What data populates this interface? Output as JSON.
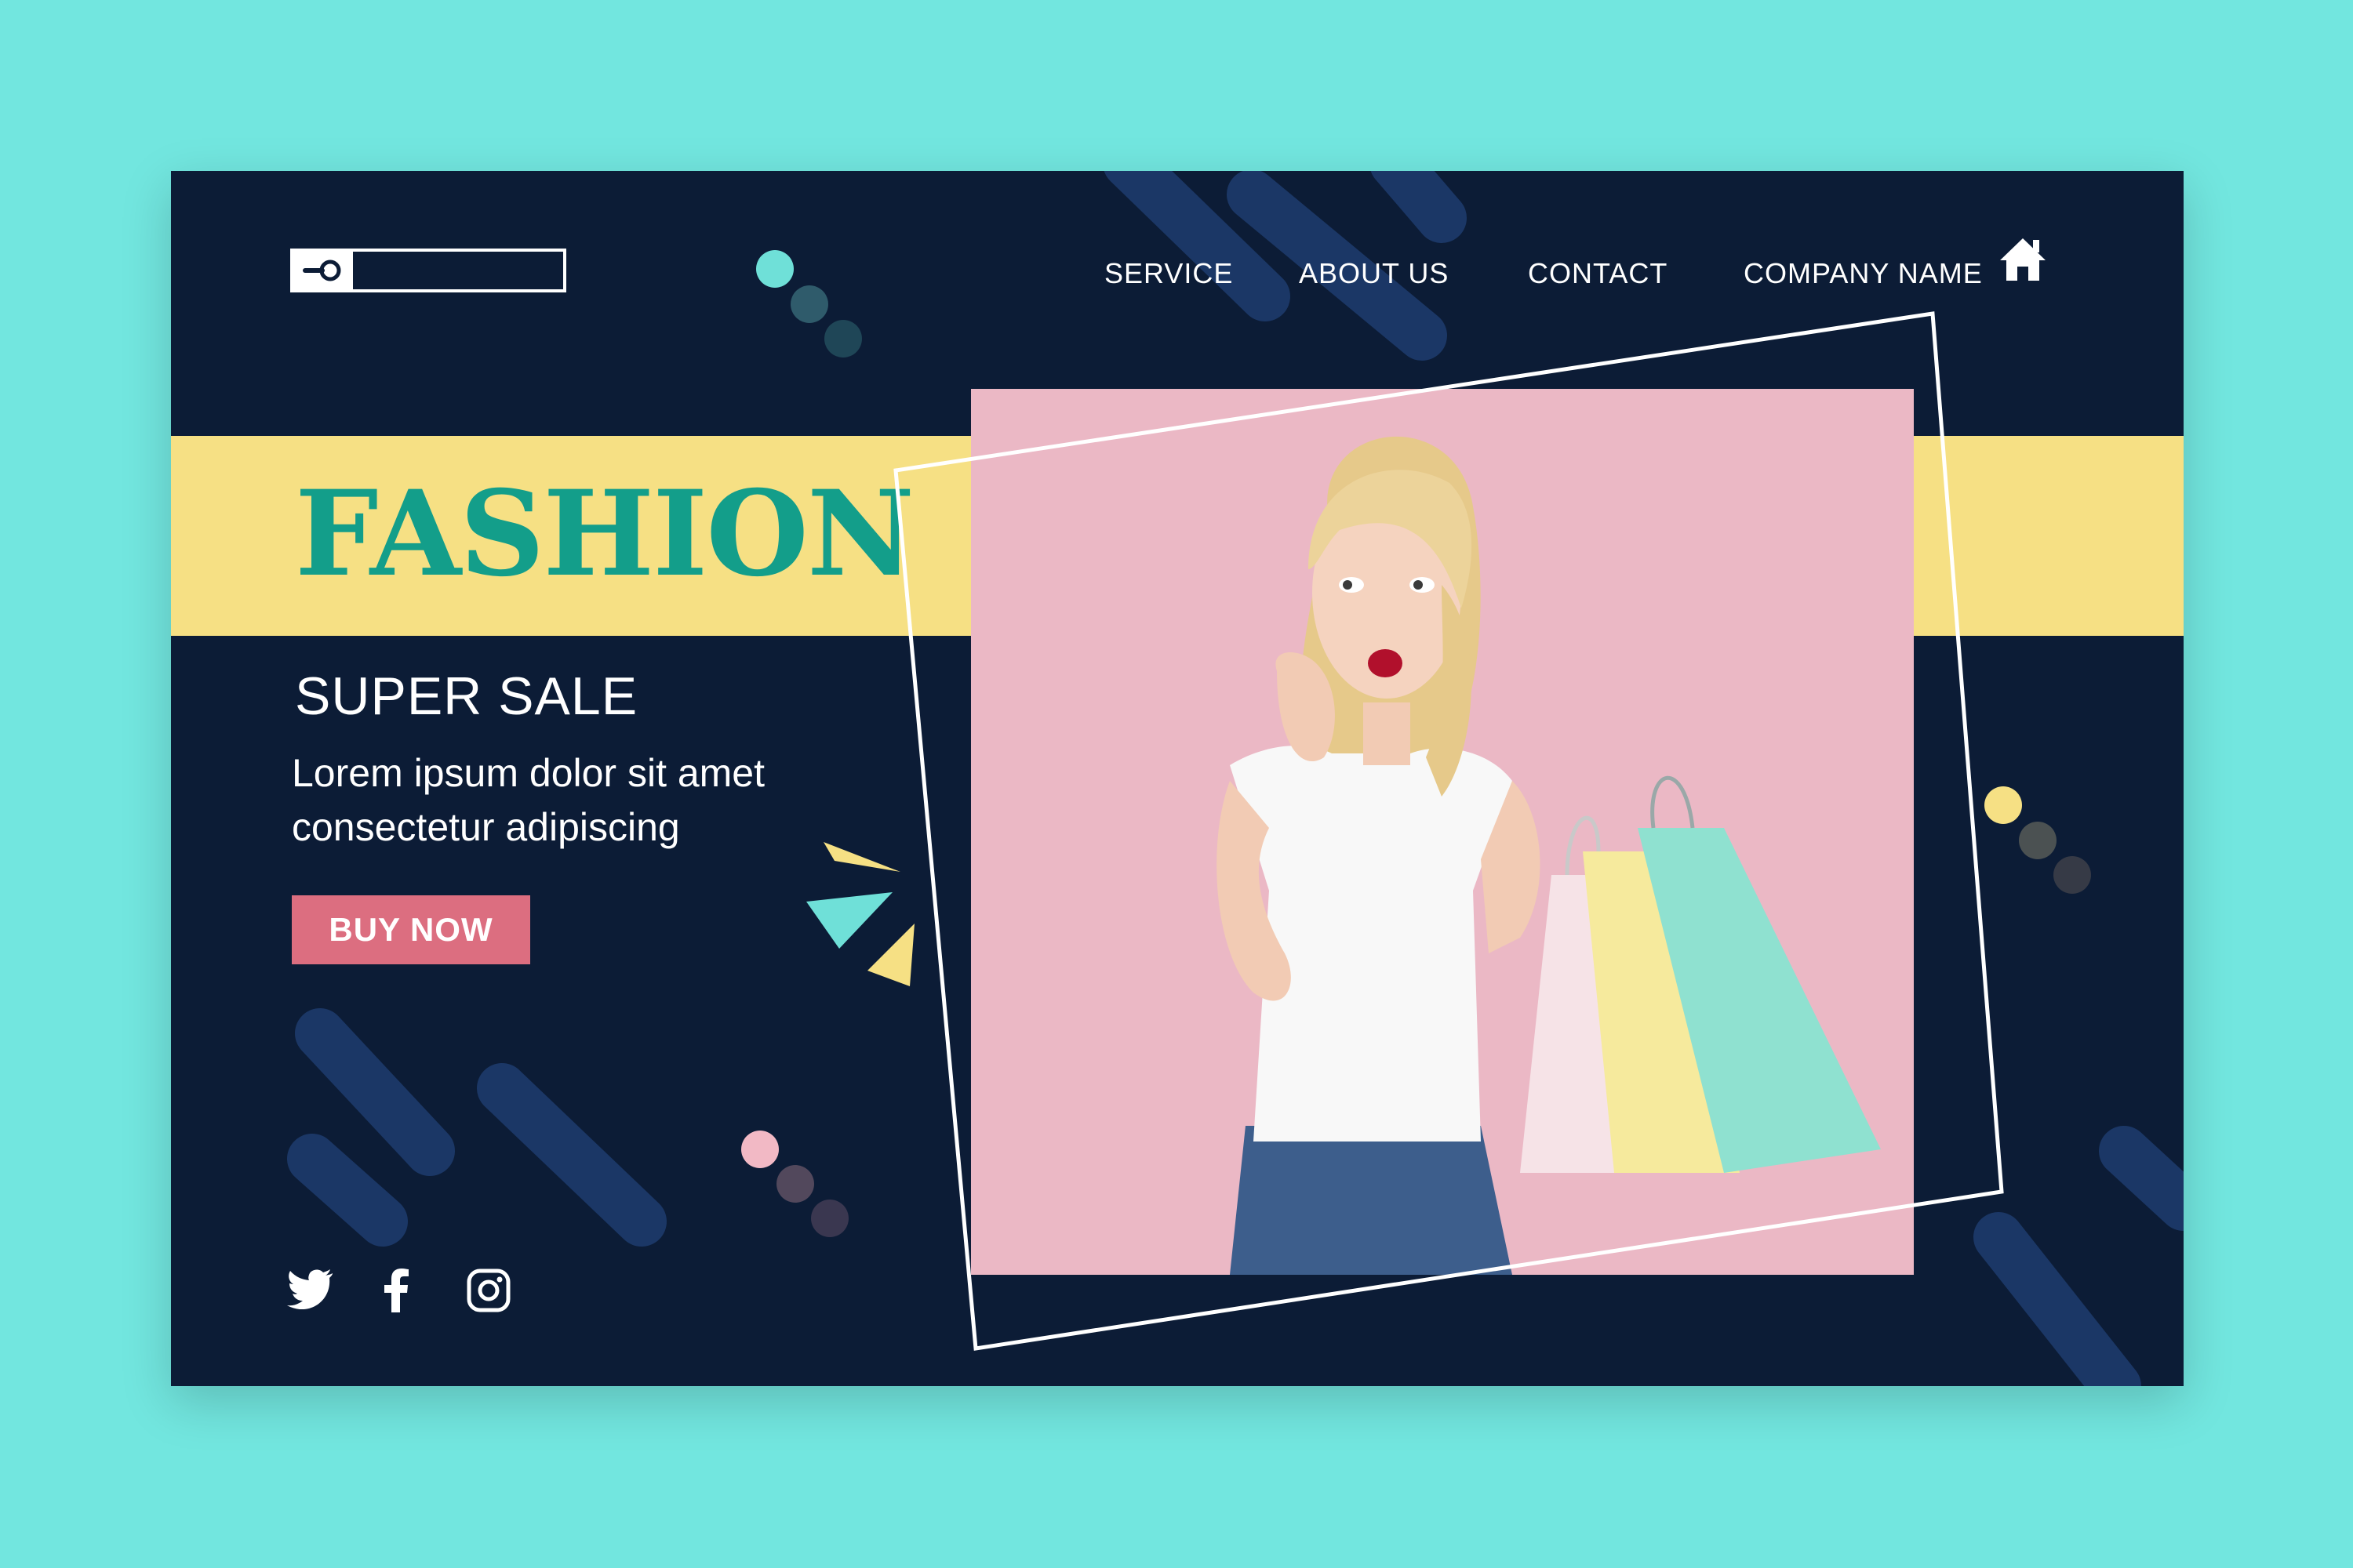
{
  "search": {
    "placeholder": ""
  },
  "nav": {
    "service": "SERVICE",
    "about": "ABOUT US",
    "contact": "CONTACT",
    "company": "COMPANY NAME"
  },
  "hero": {
    "title": "FASHION",
    "subtitle": "SUPER SALE",
    "description": "Lorem ipsum dolor sit amet consectetur adipiscing",
    "cta": "BUY NOW"
  },
  "colors": {
    "background": "#72e6df",
    "card": "#0c1c36",
    "band": "#f6e084",
    "title": "#139e8a",
    "button": "#dc6e80",
    "photo_bg": "#ebb8c5",
    "accent_teal": "#6fe0d8",
    "accent_yellow": "#f6e084",
    "accent_pink": "#dc6e80"
  },
  "icons": {
    "search": "magnifier-icon",
    "home": "home-icon",
    "social": [
      "twitter-icon",
      "facebook-icon",
      "instagram-icon"
    ]
  },
  "photo": {
    "subject": "woman-with-shopping-bags"
  }
}
